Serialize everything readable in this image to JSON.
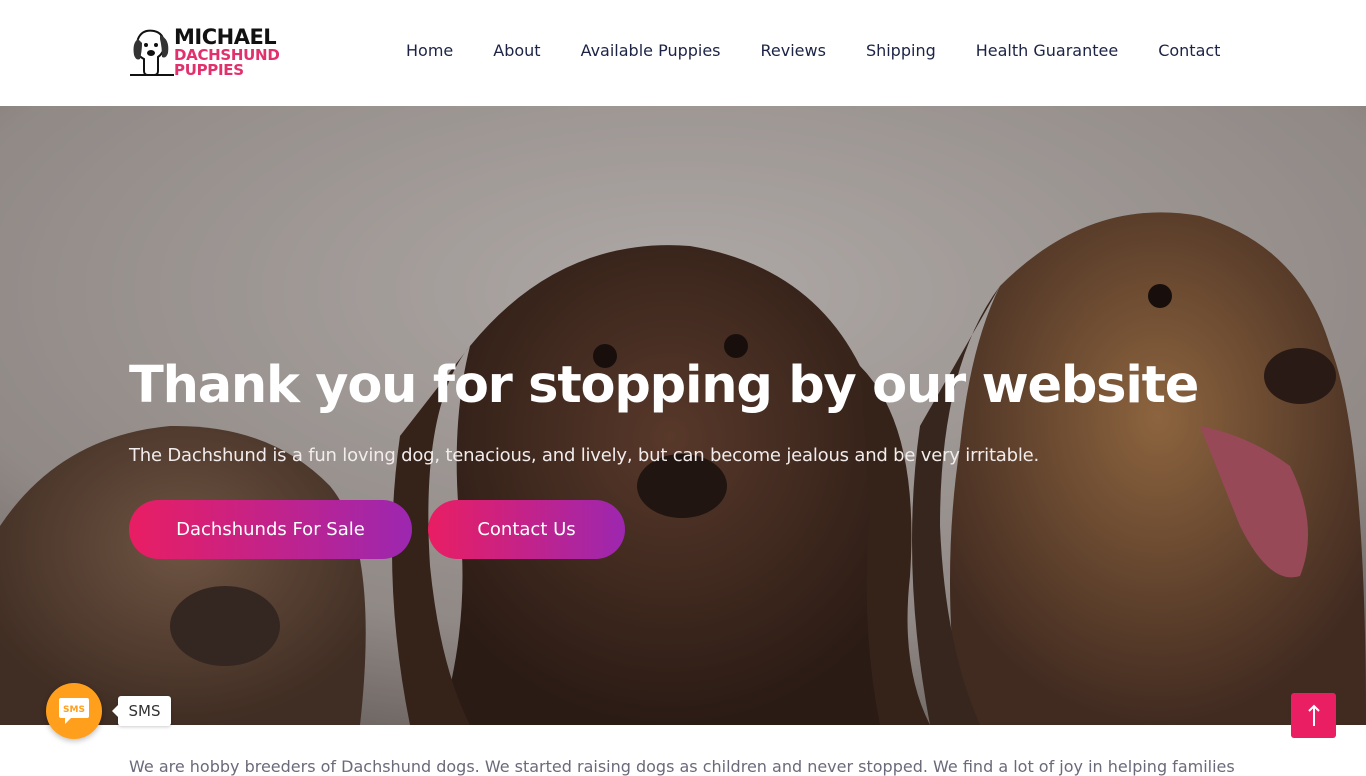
{
  "header": {
    "logo": {
      "line1": "MICHAEL",
      "line2": "DACHSHUND",
      "line3": "PUPPIES"
    },
    "nav": [
      {
        "label": "Home"
      },
      {
        "label": "About"
      },
      {
        "label": "Available Puppies"
      },
      {
        "label": "Reviews"
      },
      {
        "label": "Shipping"
      },
      {
        "label": "Health Guarantee"
      },
      {
        "label": "Contact"
      }
    ]
  },
  "hero": {
    "title": "Thank you for stopping by our website",
    "subtitle": "The Dachshund is a fun loving dog, tenacious, and lively, but can become jealous and be very irritable.",
    "buttons": {
      "sale": "Dachshunds For Sale",
      "contact": "Contact Us"
    }
  },
  "floating": {
    "sms_icon_text": "SMS",
    "sms_label": "SMS"
  },
  "intro": {
    "text": "We are hobby breeders of Dachshund dogs. We started raising dogs as children and never stopped. We find a lot of joy in helping families"
  },
  "colors": {
    "accent": "#e91e63",
    "accent2": "#9c27b0",
    "sms": "#ff9f1c",
    "nav_text": "#1c2345"
  }
}
